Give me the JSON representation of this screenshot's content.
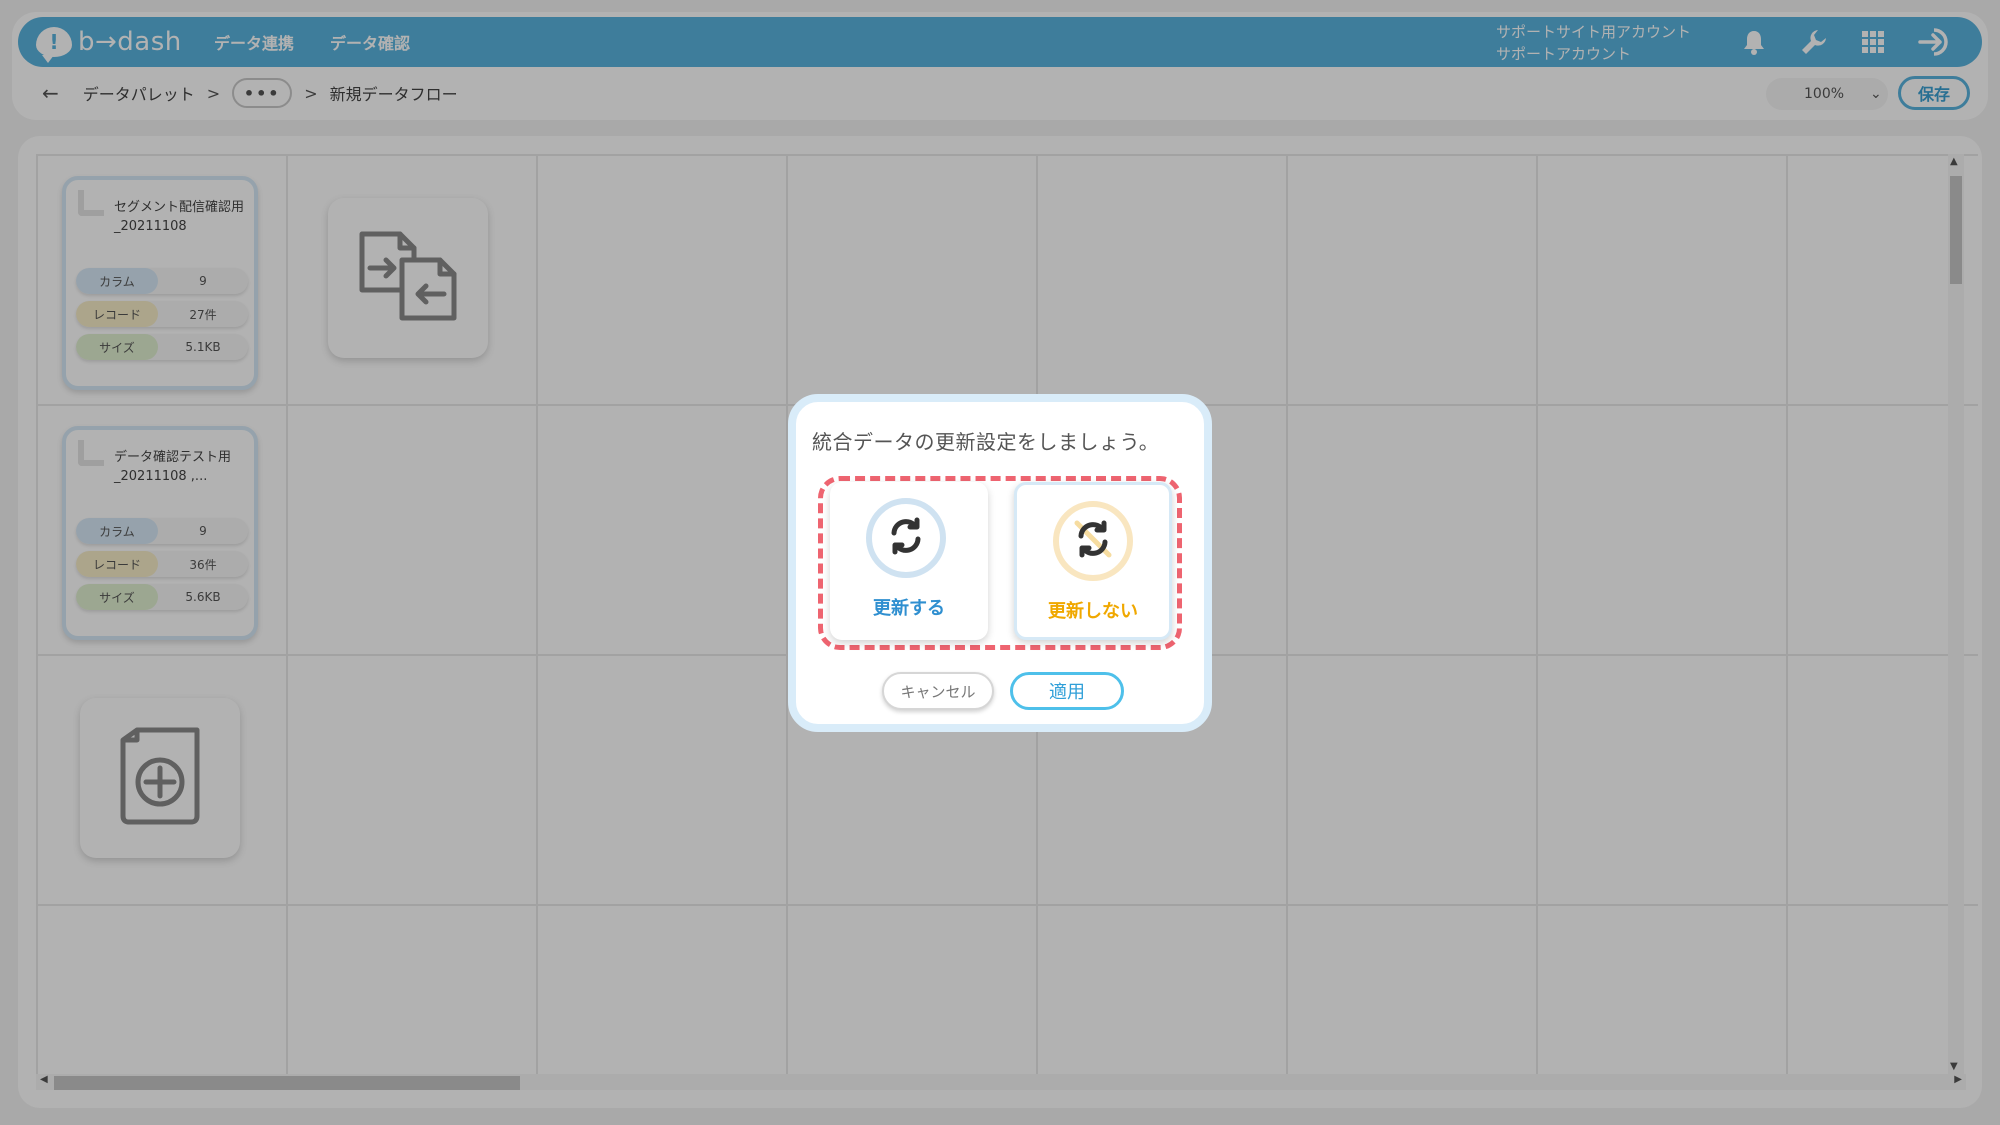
{
  "header": {
    "logo_text": "b→dash",
    "logo_mark": "!",
    "nav": [
      "データ連携",
      "データ確認"
    ],
    "account_line1": "サポートサイト用アカウント",
    "account_line2": "サポートアカウント",
    "icons": [
      "bell-icon",
      "wrench-icon",
      "apps-grid-icon",
      "logout-icon"
    ],
    "brand_color": "#5ab4de"
  },
  "breadcrumb": {
    "back": "←",
    "root": "データパレット",
    "sep": ">",
    "more": "•••",
    "current": "新規データフロー"
  },
  "toolbar": {
    "zoom": "100%",
    "zoom_chevron": "⌄",
    "save_label": "保存"
  },
  "cards": [
    {
      "title": "セグメント配信確認用_20211108",
      "stats": [
        {
          "key": "カラム",
          "value": "9"
        },
        {
          "key": "レコード",
          "value": "27件"
        },
        {
          "key": "サイズ",
          "value": "5.1KB"
        }
      ]
    },
    {
      "title": "データ確認テスト用_20211108 ,...",
      "stats": [
        {
          "key": "カラム",
          "value": "9"
        },
        {
          "key": "レコード",
          "value": "36件"
        },
        {
          "key": "サイズ",
          "value": "5.6KB"
        }
      ]
    }
  ],
  "tools": [
    "merge-data-icon",
    "add-file-icon"
  ],
  "modal": {
    "title": "統合データの更新設定をしましょう。",
    "option_update": "更新する",
    "option_no_update": "更新しない",
    "cancel_label": "キャンセル",
    "apply_label": "適用",
    "highlight_color": "#ee6470"
  }
}
